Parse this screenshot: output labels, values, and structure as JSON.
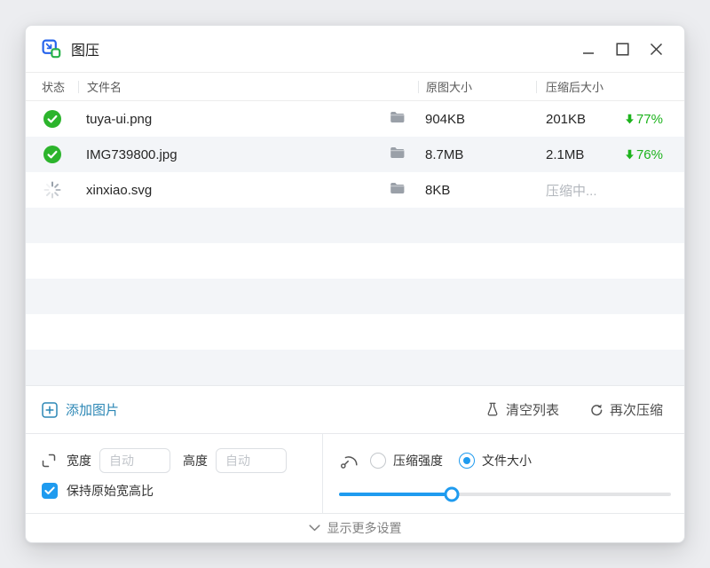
{
  "window": {
    "title": "图压"
  },
  "table": {
    "columns": {
      "status": "状态",
      "filename": "文件名",
      "original_size": "原图大小",
      "compressed_size": "压缩后大小"
    },
    "rows": [
      {
        "status": "done",
        "filename": "tuya-ui.png",
        "original_size": "904KB",
        "compressed_size": "201KB",
        "reduction": "77%"
      },
      {
        "status": "done",
        "filename": "IMG739800.jpg",
        "original_size": "8.7MB",
        "compressed_size": "2.1MB",
        "reduction": "76%"
      },
      {
        "status": "compressing",
        "filename": "xinxiao.svg",
        "original_size": "8KB",
        "compressed_size": "压缩中...",
        "reduction": ""
      }
    ],
    "empty_row_count": 5
  },
  "toolbar": {
    "add_images": "添加图片",
    "clear_list": "清空列表",
    "compress_again": "再次压缩"
  },
  "settings": {
    "width_label": "宽度",
    "width_placeholder": "自动",
    "height_label": "高度",
    "height_placeholder": "自动",
    "keep_aspect_label": "保持原始宽高比",
    "keep_aspect_checked": true,
    "mode_strength_label": "压缩强度",
    "mode_filesize_label": "文件大小",
    "selected_mode": "文件大小",
    "slider_percent": 34
  },
  "footer": {
    "show_more": "显示更多设置"
  },
  "colors": {
    "accent_blue": "#1f9bef",
    "add_button_blue": "#2c87b5",
    "success_green": "#2cb42c",
    "percent_green": "#1db31d",
    "stripe_gray": "#f3f5f8"
  },
  "icons": {
    "logo": "compress-squares-icon",
    "status_done": "check-circle-icon",
    "status_compressing": "spinner-icon",
    "file_location": "folder-icon",
    "reduction": "arrow-down-icon",
    "add": "plus-square-icon",
    "clear": "flask-icon",
    "again": "refresh-icon",
    "resize": "resize-corners-icon",
    "mode": "gauge-icon",
    "more": "chevron-down-icon"
  }
}
